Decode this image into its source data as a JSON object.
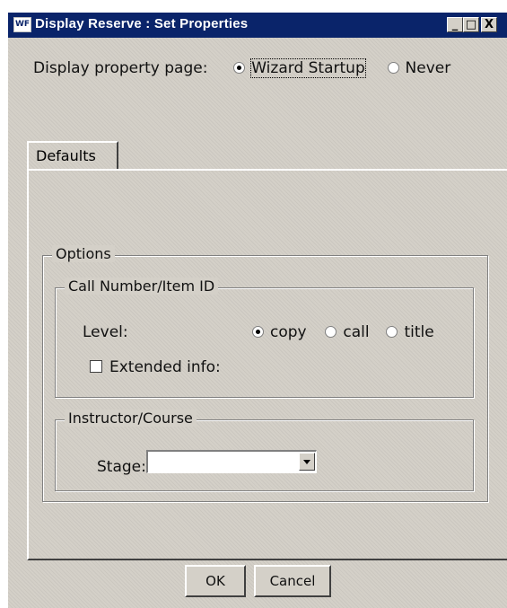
{
  "window": {
    "title": "Display Reserve : Set Properties",
    "app_icon_text": "WF"
  },
  "controls": {
    "minimize": "_",
    "maximize": "□",
    "close": "X"
  },
  "display_property_page": {
    "label": "Display property page:",
    "options": [
      {
        "label": "Wizard Startup",
        "selected": true
      },
      {
        "label": "Never",
        "selected": false
      }
    ]
  },
  "tabs": [
    {
      "label": "Defaults"
    }
  ],
  "options_group": {
    "legend": "Options",
    "call_number": {
      "legend": "Call Number/Item ID",
      "level_label": "Level:",
      "levels": [
        {
          "label": "copy",
          "selected": true
        },
        {
          "label": "call",
          "selected": false
        },
        {
          "label": "title",
          "selected": false
        }
      ],
      "extended_info_label": "Extended info:",
      "extended_info_checked": false
    },
    "instructor_course": {
      "legend": "Instructor/Course",
      "stage_label": "Stage:",
      "stage_value": ""
    }
  },
  "buttons": {
    "ok": "OK",
    "cancel": "Cancel"
  }
}
